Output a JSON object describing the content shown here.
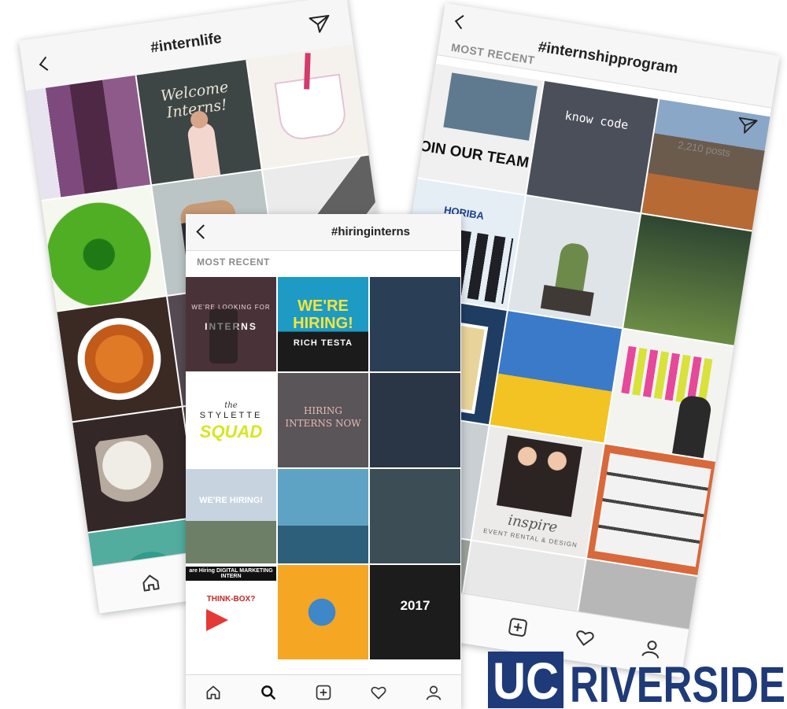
{
  "screens": [
    {
      "title": "#internlife"
    },
    {
      "title": "#internshipprogram",
      "section": "MOST RECENT",
      "posts": "2,210 posts"
    },
    {
      "title": "#hiringinterns",
      "section": "MOST RECENT"
    }
  ],
  "tiles": {
    "welcome": "Welcome Interns!",
    "looking_for": "WE'RE LOOKING FOR",
    "interns": "INTERNS",
    "were_hiring": "WE'RE HIRING!",
    "rich_testa": "RICH TESTA",
    "the": "the",
    "stylette": "STYLETTE",
    "squad": "SQUAD",
    "hiring_interns": "HIRING INTERNS NOW",
    "were_hiring_small": "WE'RE HIRING!",
    "digital": "are Hiring DIGITAL MARKETING INTERN",
    "think_box": "THINK-BOX?",
    "year": "2017",
    "join": "OIN OUR TEAM",
    "know_code": "know code",
    "horiba": "HORIBA",
    "inspire": "inspire",
    "event_rental": "EVENT RENTAL & DESIGN"
  },
  "logo": {
    "uc": "UC",
    "name": "RIVERSIDE"
  }
}
